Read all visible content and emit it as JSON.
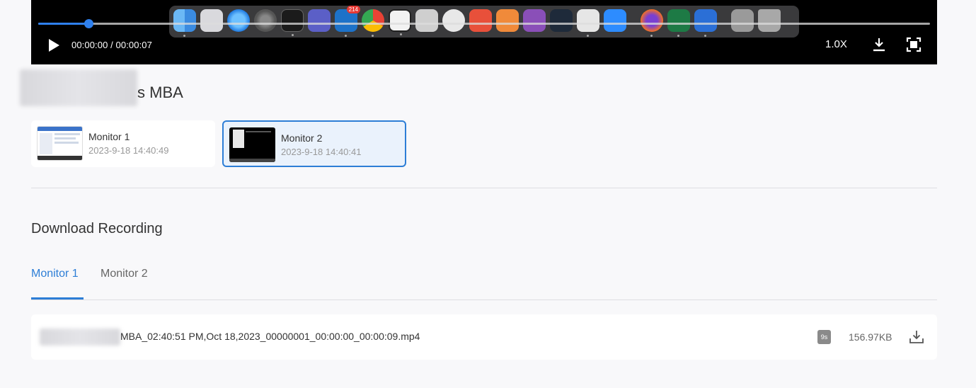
{
  "player": {
    "time_display": "00:00:00 / 00:00:07",
    "speed": "1.0X",
    "progress": 0.056,
    "accent": "#2f80ed",
    "dock_badge": "214",
    "icons": {
      "play": "play-icon",
      "download": "download-icon",
      "fullscreen": "fullscreen-icon"
    }
  },
  "device": {
    "title_suffix": "s MBA"
  },
  "monitors": [
    {
      "name": "Monitor 1",
      "time": "2023-9-18 14:40:49",
      "selected": false
    },
    {
      "name": "Monitor 2",
      "time": "2023-9-18 14:40:41",
      "selected": true
    }
  ],
  "download": {
    "title": "Download Recording",
    "tabs": [
      {
        "label": "Monitor 1",
        "active": true
      },
      {
        "label": "Monitor 2",
        "active": false
      }
    ],
    "files": [
      {
        "name": "MBA_02:40:51 PM,Oct 18,2023_00000001_00:00:00_00:00:09.mp4",
        "duration": "9s",
        "size": "156.97KB"
      }
    ]
  },
  "colors": {
    "accent": "#2d7ed6",
    "background": "#f8f8fa",
    "player_bg": "#000000"
  }
}
